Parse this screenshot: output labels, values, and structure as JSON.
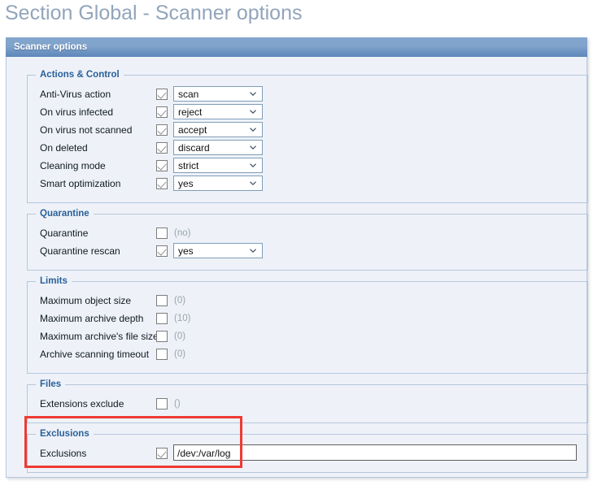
{
  "page": {
    "title": "Section Global - Scanner options",
    "accent_header": "#5d87ba",
    "legend_color": "#2a6099",
    "panel_bg": "#eef2f8",
    "highlight_color": "#ef3a33"
  },
  "panel": {
    "header_label": "Scanner options"
  },
  "sections": [
    {
      "legend": "Actions & Control",
      "rows": [
        {
          "label": "Anti-Virus action",
          "checked": true,
          "control": "select",
          "value": "scan"
        },
        {
          "label": "On virus infected",
          "checked": true,
          "control": "select",
          "value": "reject"
        },
        {
          "label": "On virus not scanned",
          "checked": true,
          "control": "select",
          "value": "accept"
        },
        {
          "label": "On deleted",
          "checked": true,
          "control": "select",
          "value": "discard"
        },
        {
          "label": "Cleaning mode",
          "checked": true,
          "control": "select",
          "value": "strict"
        },
        {
          "label": "Smart optimization",
          "checked": true,
          "control": "select",
          "value": "yes"
        }
      ]
    },
    {
      "legend": "Quarantine",
      "rows": [
        {
          "label": "Quarantine",
          "checked": false,
          "control": "text-grey",
          "value": "(no)"
        },
        {
          "label": "Quarantine rescan",
          "checked": true,
          "control": "select",
          "value": "yes"
        }
      ]
    },
    {
      "legend": "Limits",
      "rows": [
        {
          "label": "Maximum object size",
          "checked": false,
          "control": "text-grey",
          "value": "(0)"
        },
        {
          "label": "Maximum archive depth",
          "checked": false,
          "control": "text-grey",
          "value": "(10)"
        },
        {
          "label": "Maximum archive's file size",
          "checked": false,
          "control": "text-grey",
          "value": "(0)"
        },
        {
          "label": "Archive scanning timeout",
          "checked": false,
          "control": "text-grey",
          "value": "(0)"
        }
      ]
    },
    {
      "legend": "Files",
      "rows": [
        {
          "label": "Extensions exclude",
          "checked": false,
          "control": "text-grey",
          "value": "()"
        }
      ]
    },
    {
      "legend": "Exclusions",
      "highlighted": true,
      "rows": [
        {
          "label": "Exclusions",
          "checked": true,
          "control": "input",
          "value": "/dev:/var/log",
          "placeholder": ""
        }
      ]
    }
  ]
}
